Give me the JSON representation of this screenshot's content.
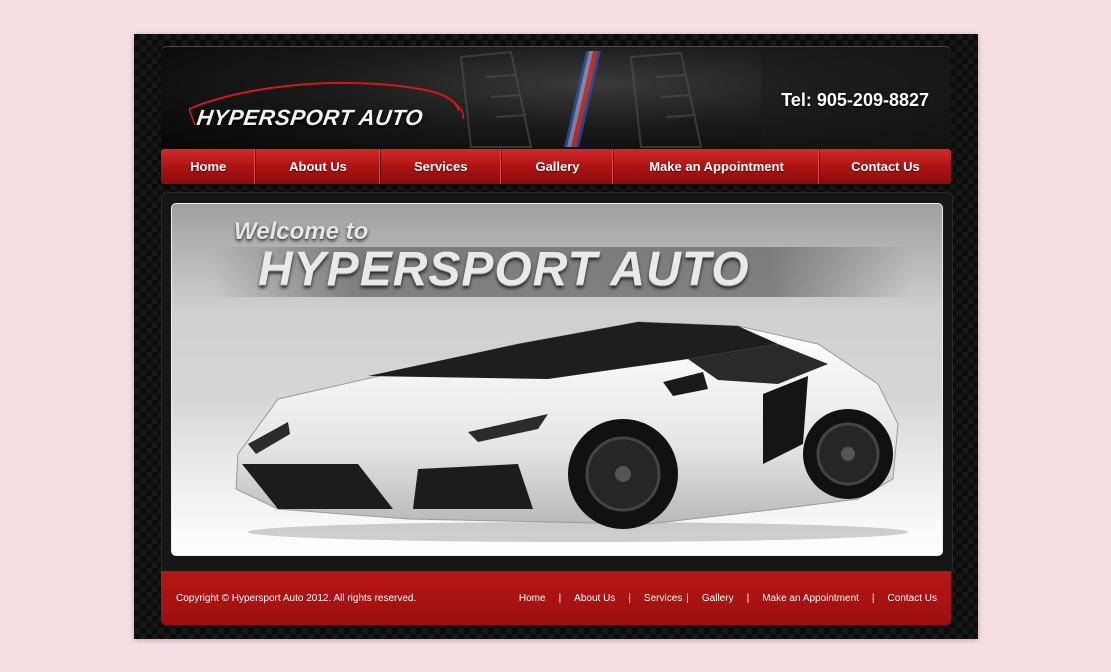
{
  "header": {
    "logo_text": "HYPERSPORT AUTO",
    "phone": "Tel: 905-209-8827"
  },
  "nav": {
    "items": [
      {
        "label": "Home"
      },
      {
        "label": "About Us"
      },
      {
        "label": "Services"
      },
      {
        "label": "Gallery"
      },
      {
        "label": "Make an Appointment"
      },
      {
        "label": "Contact Us"
      }
    ]
  },
  "hero": {
    "welcome": "Welcome to",
    "title": "HYPERSPORT AUTO"
  },
  "footer": {
    "copyright": "Copyright © Hypersport Auto 2012. All rights reserved.",
    "separator": "|",
    "links": [
      {
        "label": "Home"
      },
      {
        "label": "About Us"
      },
      {
        "label": "Services"
      },
      {
        "label": "Gallery"
      },
      {
        "label": "Make an Appointment"
      },
      {
        "label": "Contact Us"
      }
    ]
  },
  "colors": {
    "brand_red": "#b71717",
    "page_background": "#f7e0e4",
    "dark_background": "#0c0c0c"
  }
}
